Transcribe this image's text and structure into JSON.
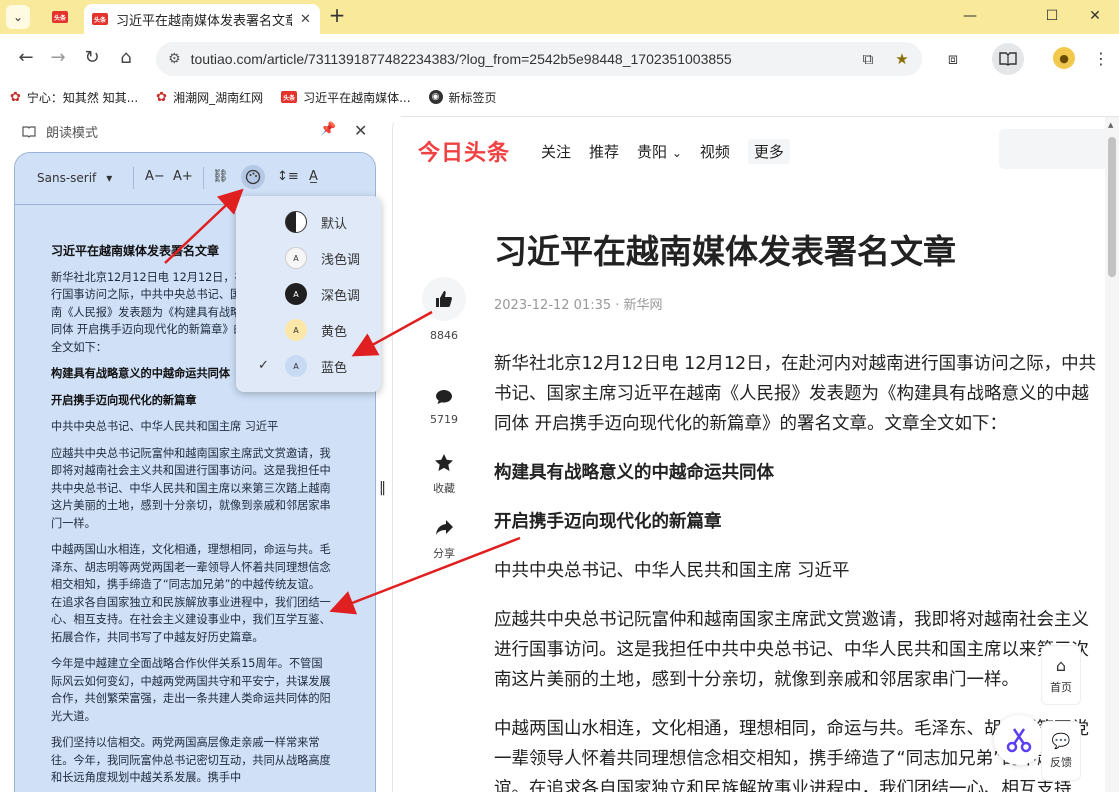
{
  "tabs": {
    "inactive_label": "头条",
    "active_favicon": "头条",
    "active_title": "习近平在越南媒体发表署名文章",
    "new_tab": "+"
  },
  "omnibox": {
    "url": "toutiao.com/article/7311391877482234383/?log_from=2542b5e98448_1702351003855"
  },
  "bookmarks": [
    {
      "label": "宁心：知其然 知其..."
    },
    {
      "label": "湘潮网_湖南红网"
    },
    {
      "label": "习近平在越南媒体..."
    },
    {
      "label": "新标签页"
    }
  ],
  "reading_panel": {
    "title": "朗读模式",
    "font": "Sans-serif",
    "font_smaller": "A−",
    "font_larger": "A+",
    "theme_menu": [
      {
        "label": "默认",
        "swatch": "default",
        "checked": false
      },
      {
        "label": "浅色调",
        "swatch": "light",
        "checked": false
      },
      {
        "label": "深色调",
        "swatch": "dark",
        "checked": false
      },
      {
        "label": "黄色",
        "swatch": "yellow",
        "checked": false
      },
      {
        "label": "蓝色",
        "swatch": "blue",
        "checked": true
      }
    ],
    "swatch_letter": "A",
    "content": {
      "title": "习近平在越南媒体发表署名文章",
      "p1": "新华社北京12月12日电 12月12日，在赴河内对越南进行国事访问之际，中共中央总书记、国家主席习近平在越南《人民报》发表题为《构建具有战略意义的中越命运共同体 开启携手迈向现代化的新篇章》的署名文章。文章全文如下：",
      "h1": "构建具有战略意义的中越命运共同体",
      "h2": "开启携手迈向现代化的新篇章",
      "author": "中共中央总书记、中华人民共和国主席 习近平",
      "p2": "应越共中央总书记阮富仲和越南国家主席武文赏邀请，我即将对越南社会主义共和国进行国事访问。这是我担任中共中央总书记、中华人民共和国主席以来第三次踏上越南这片美丽的土地，感到十分亲切，就像到亲戚和邻居家串门一样。",
      "p3": "中越两国山水相连，文化相通，理想相同，命运与共。毛泽东、胡志明等两党两国老一辈领导人怀着共同理想信念相交相知，携手缔造了“同志加兄弟”的中越传统友谊。在追求各自国家独立和民族解放事业进程中，我们团结一心、相互支持。在社会主义建设事业中，我们互学互鉴、拓展合作，共同书写了中越友好历史篇章。",
      "p4": "今年是中越建立全面战略合作伙伴关系15周年。不管国际风云如何变幻，中越两党两国共守和平安宁，共谋发展合作，共创繁荣富强，走出一条共建人类命运共同体的阳光大道。",
      "p5": "我们坚持以信相交。两党两国高层像走亲戚一样常来常往。今年，我同阮富仲总书记密切互动，共同从战略高度和长远角度规划中越关系发展。携手中"
    }
  },
  "main": {
    "logo": "今日头条",
    "nav": [
      "关注",
      "推荐",
      "贵阳",
      "视频",
      "更多"
    ],
    "headline": "习近平在越南媒体发表署名文章",
    "meta": "2023-12-12 01:35 · 新华网",
    "actions": [
      {
        "label": "8846"
      },
      {
        "label": "5719"
      },
      {
        "label": "收藏"
      },
      {
        "label": "分享"
      }
    ],
    "article": {
      "p1_l1": "新华社北京12月12日电 12月12日，在赴河内对越南进行国事访问之际，中共",
      "p1_l2": "书记、国家主席习近平在越南《人民报》发表题为《构建具有战略意义的中越",
      "p1_l3": "同体 开启携手迈向现代化的新篇章》的署名文章。文章全文如下：",
      "h1": "构建具有战略意义的中越命运共同体",
      "h2": "开启携手迈向现代化的新篇章",
      "author": "中共中央总书记、中华人民共和国主席 习近平",
      "p2_l1": "应越共中央总书记阮富仲和越南国家主席武文赏邀请，我即将对越南社会主义",
      "p2_l2": "进行国事访问。这是我担任中共中央总书记、中华人民共和国主席以来第三次",
      "p2_l3": "南这片美丽的土地，感到十分亲切，就像到亲戚和邻居家串门一样。",
      "p3_l1": "中越两国山水相连，文化相通，理想相同，命运与共。毛泽东、胡志明等两党",
      "p3_l2": "一辈领导人怀着共同理想信念相交相知，携手缔造了“同志加兄弟”的中越",
      "p3_l3": "谊。在追求各自国家独立和民族解放事业进程中，我们团结一心、相互支持"
    },
    "float_home": "首页",
    "float_feedback": "反馈"
  },
  "colors": {
    "tab_strip": "#f9e99a",
    "reading_bg": "#cfe0f7",
    "brand_red": "#f04142",
    "arrow_red": "#e02020"
  }
}
